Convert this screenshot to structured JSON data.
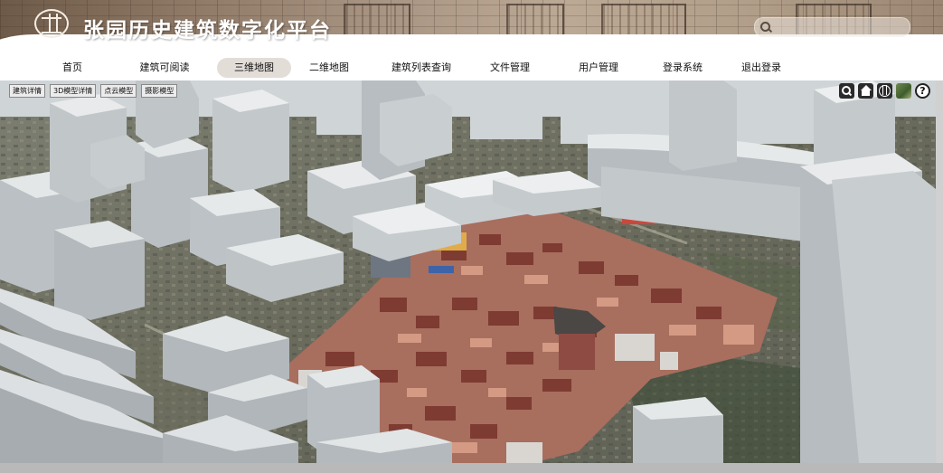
{
  "header": {
    "title": "张园历史建筑数字化平台",
    "search_placeholder": ""
  },
  "nav": {
    "items": [
      "首页",
      "建筑可阅读",
      "三维地图",
      "二维地图",
      "建筑列表查询",
      "文件管理",
      "用户管理",
      "登录系统",
      "退出登录"
    ],
    "active": "三维地图"
  },
  "map_toolbar": {
    "buttons": [
      "建筑详情",
      "3D模型详情",
      "点云模型",
      "摄影模型"
    ]
  },
  "map_controls": {
    "icons": [
      "search-icon",
      "home-icon",
      "globe-icon",
      "basemap-layer-icon",
      "help-icon"
    ],
    "help_label": "?"
  },
  "colors": {
    "banner": "#a89482",
    "nav_active": "#e3ddd8",
    "building_white": "#dfe3e5",
    "roof_red": "#8a3d33"
  }
}
